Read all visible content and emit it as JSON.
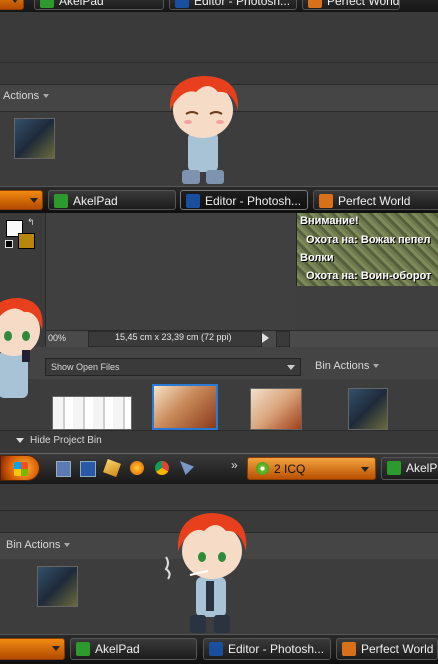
{
  "strip1": {
    "tasks": [
      {
        "label": "AkelPad"
      },
      {
        "label": "Editor - Photosh..."
      },
      {
        "label": "Perfect World"
      }
    ],
    "actions_label": "Actions"
  },
  "strip2": {
    "tasks": [
      {
        "label": "AkelPad"
      },
      {
        "label": "Editor - Photosh..."
      },
      {
        "label": "Perfect World"
      }
    ]
  },
  "game_chat": {
    "lines": [
      {
        "text": "Внимание!"
      },
      {
        "text": "Охота на: Вожак пепел"
      },
      {
        "text": "Волки"
      },
      {
        "text": "Охота на: Воин-оборот"
      }
    ]
  },
  "status_bar": {
    "zoom": "00%",
    "doc_size": "15,45 cm x 23,39 cm (72 ppi)"
  },
  "project_bin": {
    "show_select": "Show Open Files",
    "bin_actions": "Bin Actions",
    "hide_label": "Hide Project Bin"
  },
  "windows_taskbar": {
    "icq_label": "2 ICQ",
    "akelpad_label": "AkelPa"
  },
  "lower": {
    "bin_actions": "Bin Actions"
  },
  "strip3": {
    "tasks": [
      {
        "label": "AkelPad"
      },
      {
        "label": "Editor - Photosh..."
      },
      {
        "label": "Perfect World"
      }
    ]
  },
  "colors": {
    "accent_orange": "#e07a10",
    "selection_blue": "#2b7bd6"
  }
}
